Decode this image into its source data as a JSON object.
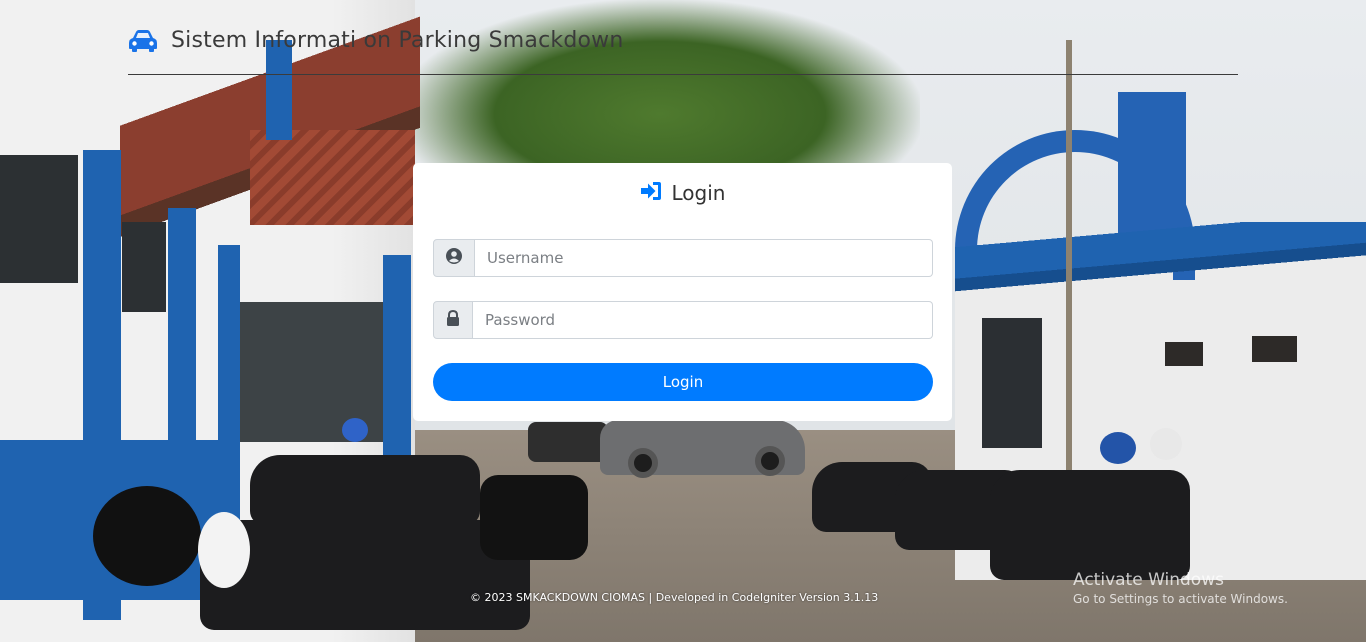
{
  "header": {
    "title": "Sistem Informati on Parking Smackdown",
    "icon": "car-icon",
    "icon_color": "#1a73e8"
  },
  "login": {
    "title": "Login",
    "title_icon": "sign-in-icon",
    "username_placeholder": "Username",
    "username_icon": "user-circle-icon",
    "password_placeholder": "Password",
    "password_icon": "lock-icon",
    "button_label": "Login",
    "accent_color": "#007bff"
  },
  "footer": {
    "text": "© 2023 SMKACKDOWN CIOMAS | Developed in CodeIgniter Version 3.1.13"
  },
  "watermark": {
    "title": "Activate Windows",
    "subtitle": "Go to Settings to activate Windows."
  }
}
